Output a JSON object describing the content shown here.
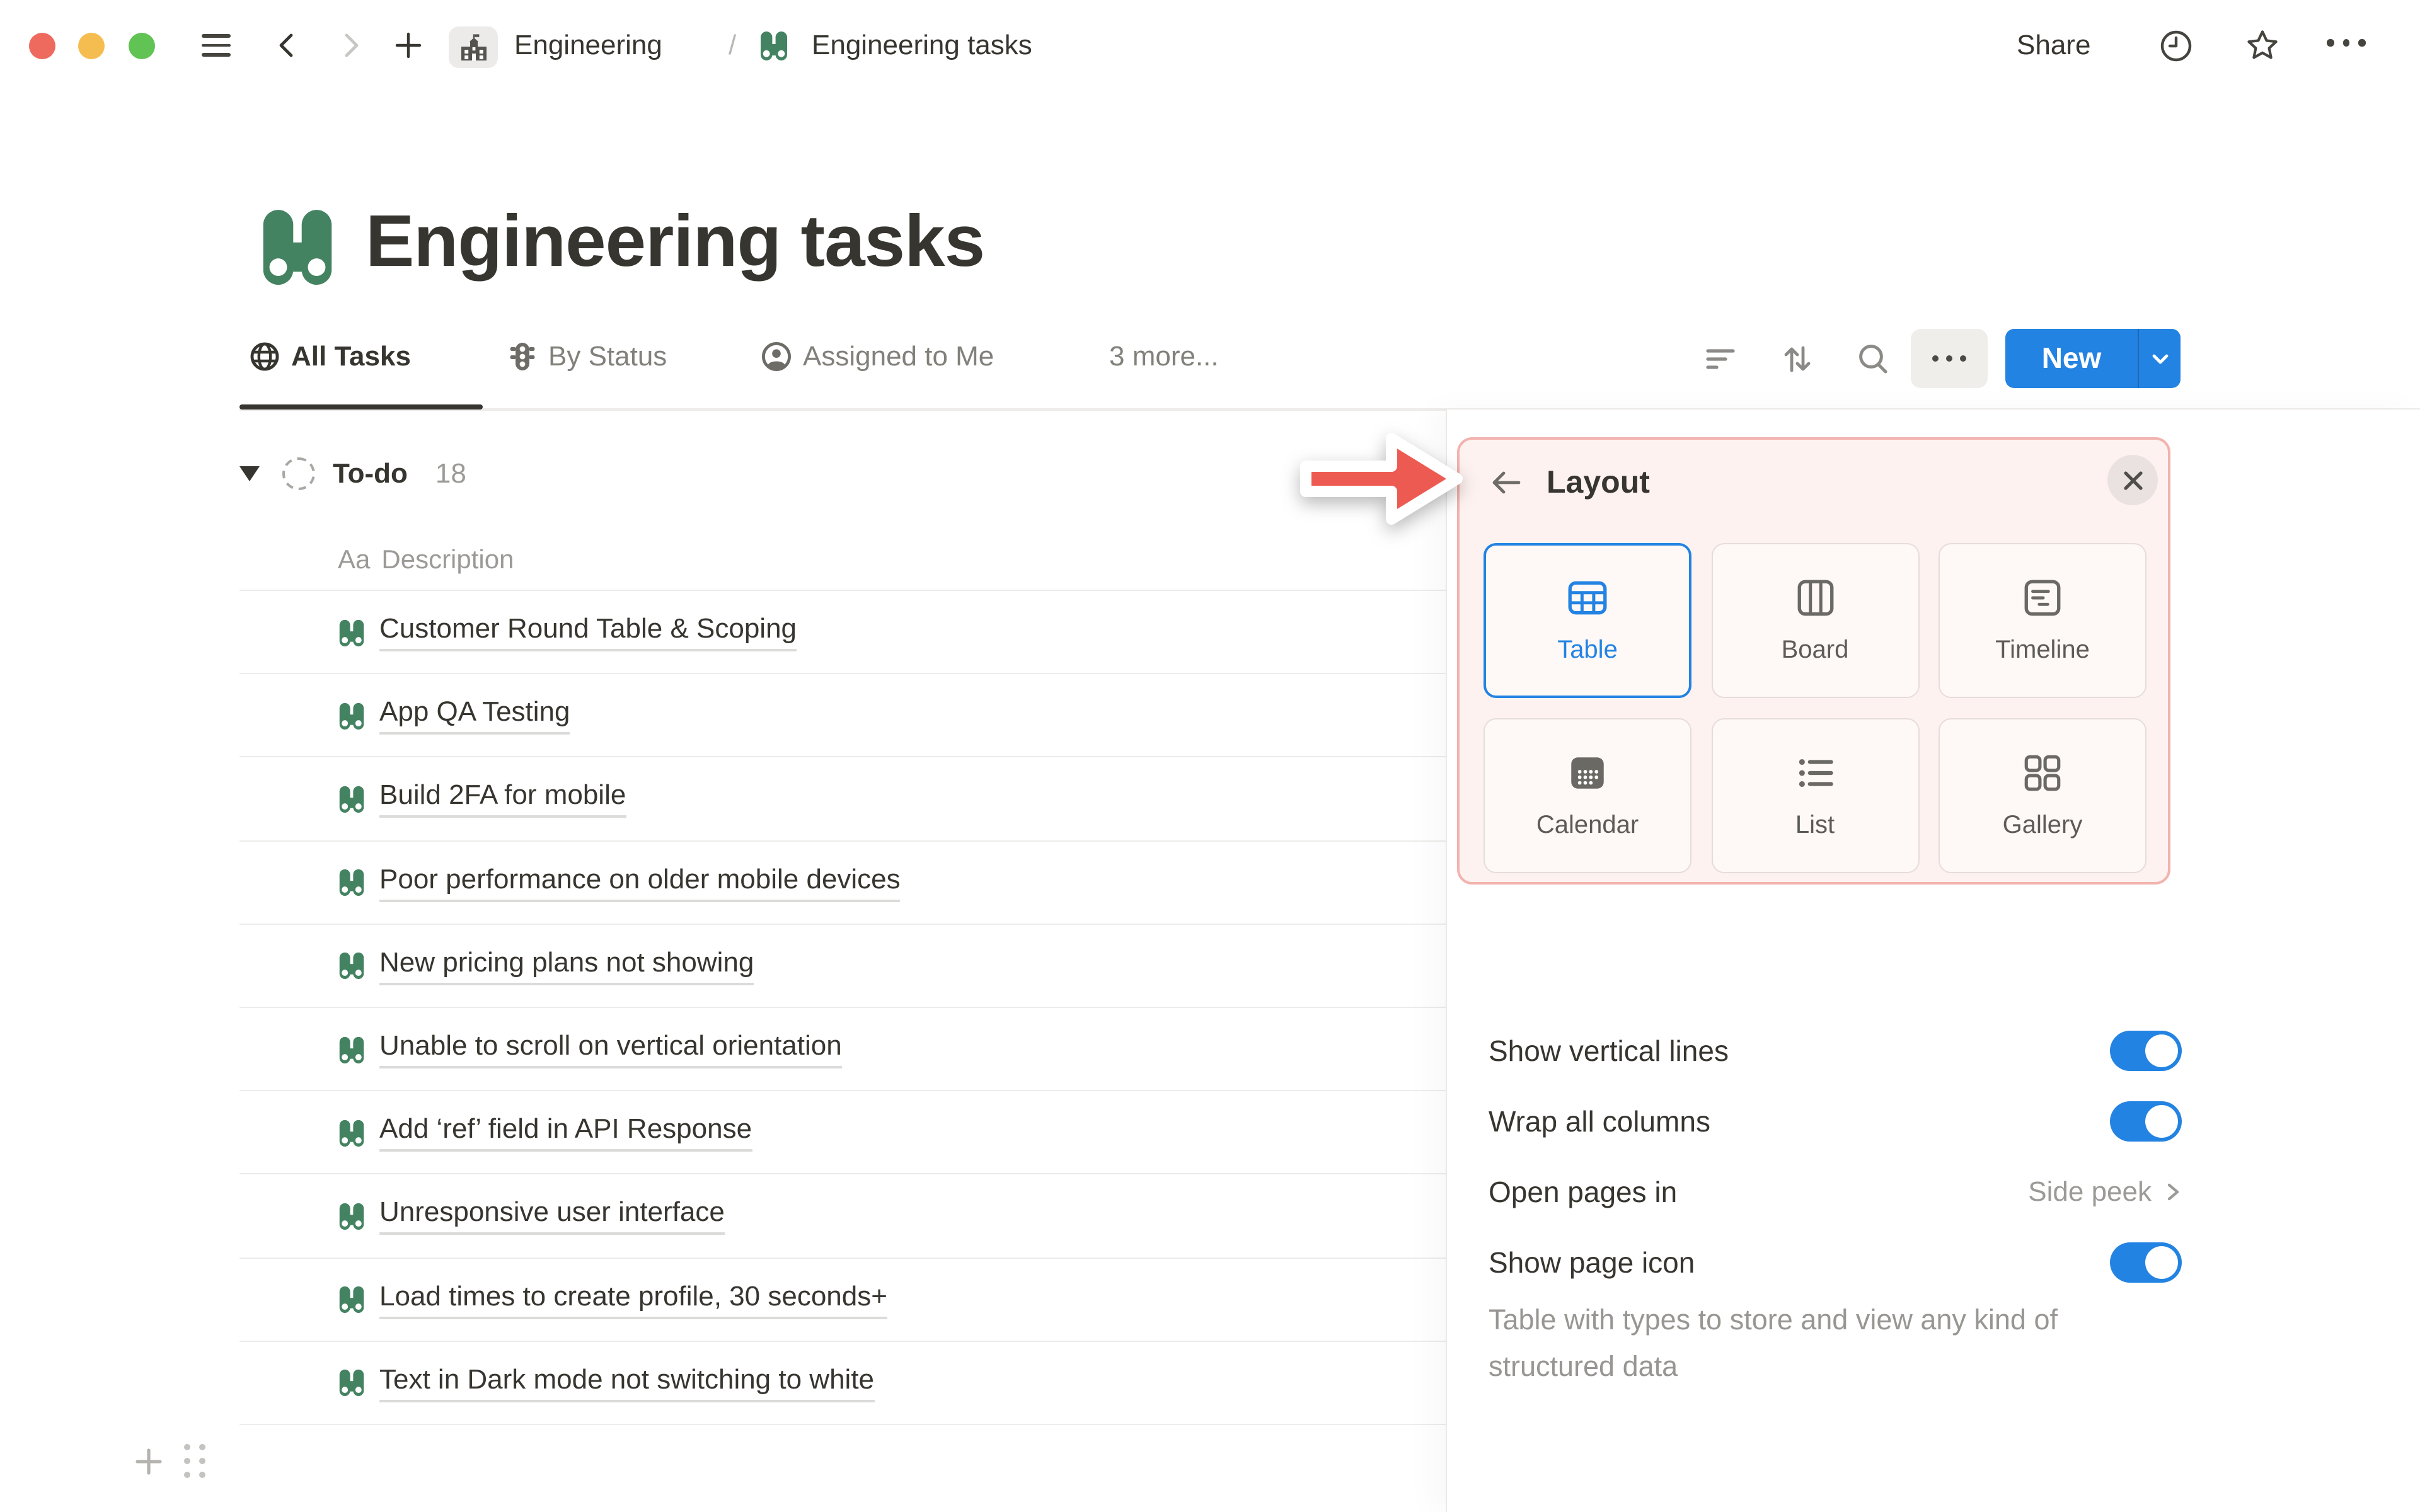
{
  "topbar": {
    "breadcrumb": {
      "teamspace": "Engineering",
      "separator": "/",
      "page": "Engineering tasks"
    },
    "share_label": "Share"
  },
  "page": {
    "title": "Engineering tasks"
  },
  "view_tabs": {
    "tabs": [
      {
        "label": "All Tasks",
        "active": true
      },
      {
        "label": "By Status",
        "active": false
      },
      {
        "label": "Assigned to Me",
        "active": false
      },
      {
        "label": "3 more...",
        "active": false
      }
    ]
  },
  "toolbar": {
    "new_label": "New"
  },
  "table": {
    "group": {
      "name": "To-do",
      "count": "18"
    },
    "header": {
      "type_abbrev": "Aa",
      "label": "Description"
    },
    "rows": [
      {
        "title": "Customer Round Table & Scoping"
      },
      {
        "title": "App QA Testing"
      },
      {
        "title": "Build 2FA for mobile"
      },
      {
        "title": "Poor performance on older mobile devices"
      },
      {
        "title": "New pricing plans not showing"
      },
      {
        "title": "Unable to scroll on vertical orientation"
      },
      {
        "title": "Add ‘ref’ field in API Response"
      },
      {
        "title": "Unresponsive user interface"
      },
      {
        "title": "Load times to create profile, 30 seconds+"
      },
      {
        "title": "Text in Dark mode not switching to white"
      }
    ]
  },
  "layout_panel": {
    "title": "Layout",
    "options": [
      {
        "label": "Table",
        "selected": true
      },
      {
        "label": "Board",
        "selected": false
      },
      {
        "label": "Timeline",
        "selected": false
      },
      {
        "label": "Calendar",
        "selected": false
      },
      {
        "label": "List",
        "selected": false
      },
      {
        "label": "Gallery",
        "selected": false
      }
    ],
    "description": "Table with types to store and view any kind of structured data",
    "settings": {
      "vertical_lines": {
        "label": "Show vertical lines",
        "value": "on"
      },
      "wrap_columns": {
        "label": "Wrap all columns",
        "value": "on"
      },
      "open_pages": {
        "label": "Open pages in",
        "value": "Side peek"
      },
      "page_icon": {
        "label": "Show page icon",
        "value": "on"
      }
    }
  },
  "colors": {
    "accent_blue": "#2383E2",
    "notion_green": "#448361",
    "arrow_red": "#ED5A52",
    "traffic_red": "#EE6A5F",
    "traffic_yellow": "#F5BD4F",
    "traffic_green": "#61C354"
  }
}
